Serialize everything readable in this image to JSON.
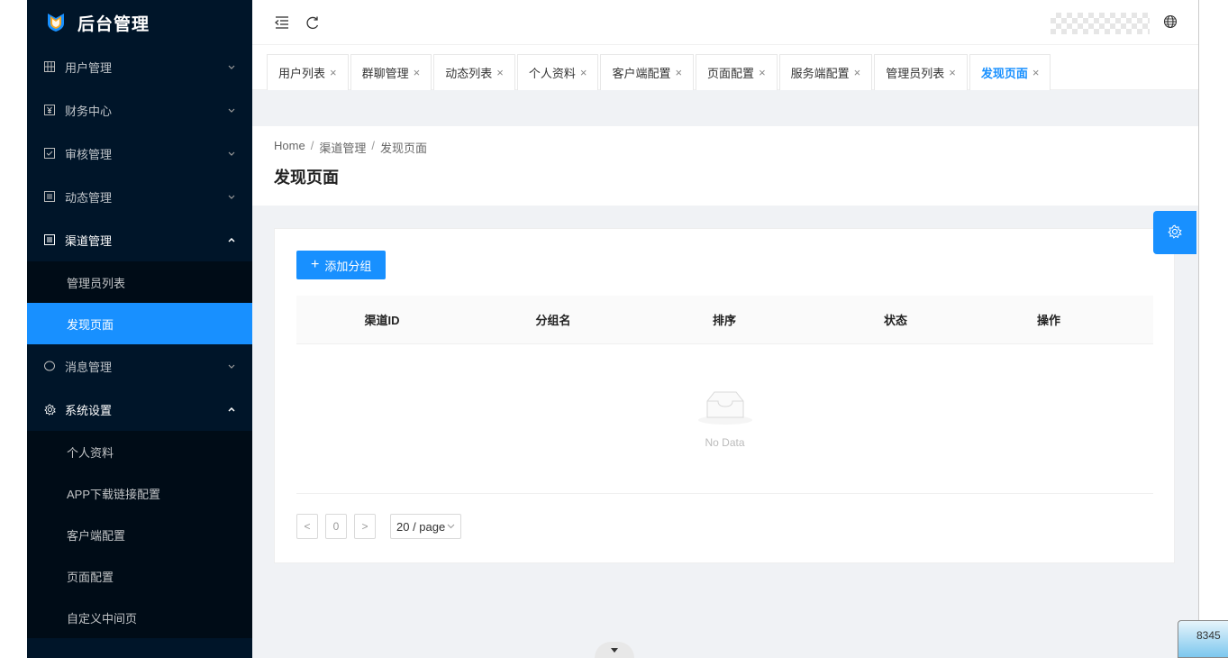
{
  "app": {
    "title": "后台管理",
    "accent": "#1890ff",
    "sidebar_bg": "#001529"
  },
  "sidebar": {
    "items": [
      {
        "label": "用户管理",
        "icon": "table-icon",
        "expanded": false
      },
      {
        "label": "财务中心",
        "icon": "finance-icon",
        "expanded": false
      },
      {
        "label": "审核管理",
        "icon": "check-square-icon",
        "expanded": false
      },
      {
        "label": "动态管理",
        "icon": "list-icon",
        "expanded": false
      },
      {
        "label": "渠道管理",
        "icon": "list-icon",
        "expanded": true,
        "children": [
          {
            "label": "管理员列表"
          },
          {
            "label": "发现页面",
            "active": true
          }
        ]
      },
      {
        "label": "消息管理",
        "icon": "message-icon",
        "expanded": false
      },
      {
        "label": "系统设置",
        "icon": "gear-icon",
        "expanded": true,
        "children": [
          {
            "label": "个人资料"
          },
          {
            "label": "APP下载链接配置"
          },
          {
            "label": "客户端配置"
          },
          {
            "label": "页面配置"
          },
          {
            "label": "自定义中间页"
          }
        ]
      }
    ]
  },
  "topbar": {
    "collapse_icon": "menu-fold-icon",
    "refresh_icon": "reload-icon",
    "lang_icon": "globe-icon"
  },
  "tabs": [
    {
      "label": "用户列表",
      "close": "×"
    },
    {
      "label": "群聊管理",
      "close": "×"
    },
    {
      "label": "动态列表",
      "close": "×"
    },
    {
      "label": "个人资料",
      "close": "×"
    },
    {
      "label": "客户端配置",
      "close": "×"
    },
    {
      "label": "页面配置",
      "close": "×"
    },
    {
      "label": "服务端配置",
      "close": "×"
    },
    {
      "label": "管理员列表",
      "close": "×"
    },
    {
      "label": "发现页面",
      "close": "×",
      "active": true
    }
  ],
  "page": {
    "breadcrumb": [
      "Home",
      "渠道管理",
      "发现页面"
    ],
    "breadcrumb_sep": "/",
    "title": "发现页面"
  },
  "content": {
    "add_button": "添加分组",
    "add_icon": "+",
    "columns": [
      "渠道ID",
      "分组名",
      "排序",
      "状态",
      "操作"
    ],
    "empty_text": "No Data",
    "pagination": {
      "prev": "<",
      "page": "0",
      "next": ">",
      "page_size": "20 / page"
    }
  },
  "corner_badge": "8345"
}
